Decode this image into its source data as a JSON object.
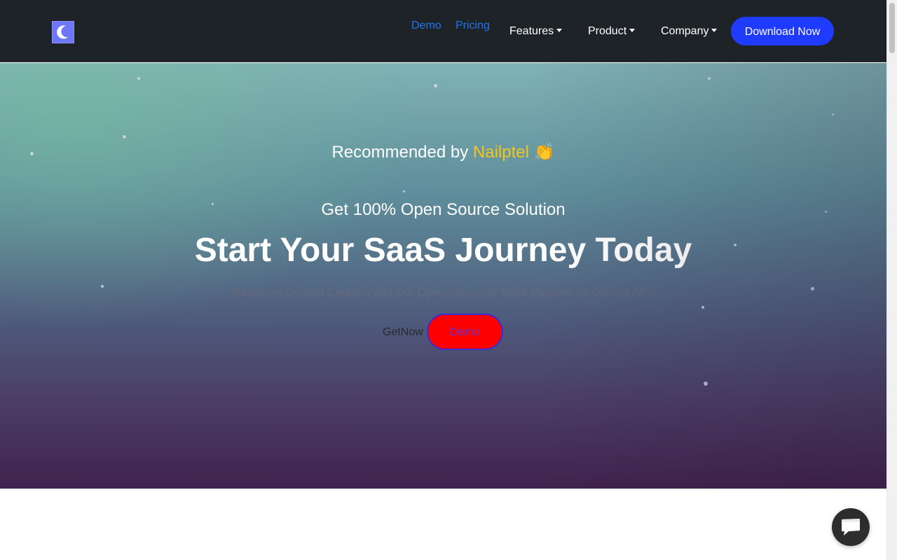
{
  "nav": {
    "logo_icon": "crescent-logo-icon",
    "demo_label": "Demo",
    "pricing_label": "Pricing",
    "features_label": "Features",
    "product_label": "Product",
    "company_label": "Company",
    "download_label": "Download Now"
  },
  "hero": {
    "recommend_prefix": "Recommended by ",
    "recommend_brand": "Nailptel",
    "recommend_emoji": "👏",
    "subtitle": "Get 100% Open Source Solution",
    "headline": "Start Your SaaS Journey Today",
    "tagline": "Transform Content Creation with Our Open-Source AI SaaS Platform on OpenAI APIs",
    "getnow_label": "GetNow",
    "demo_label": "Demo"
  },
  "colors": {
    "nav_bg": "#1d2327",
    "link_blue": "#1f73f2",
    "download_bg": "#1f3bff",
    "brand_yellow": "#f5c518",
    "demo_btn_bg": "#ff0000"
  },
  "chat": {
    "icon": "chat-bubble-icon"
  }
}
